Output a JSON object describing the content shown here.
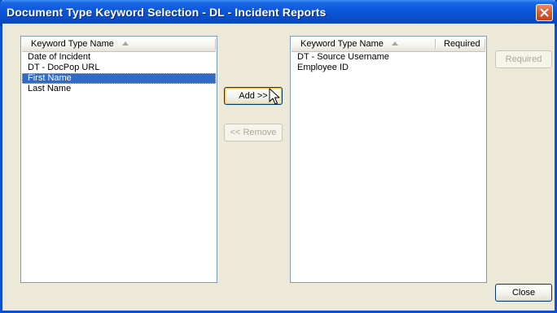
{
  "window": {
    "title": "Document Type Keyword Selection - DL - Incident Reports"
  },
  "available_list": {
    "header": "Keyword Type Name",
    "items": [
      "Date of Incident",
      "DT - DocPop URL",
      "First Name",
      "Last Name"
    ],
    "selected_index": 2
  },
  "assigned_list": {
    "header_name": "Keyword Type Name",
    "header_required": "Required",
    "items": [
      "DT - Source Username",
      "Employee ID"
    ]
  },
  "buttons": {
    "add": "Add >>",
    "remove": "<< Remove",
    "required": "Required",
    "close": "Close"
  },
  "colors": {
    "selection": "#316ac5",
    "titlebar": "#0a55d8",
    "dialog_background": "#ece9d8"
  }
}
